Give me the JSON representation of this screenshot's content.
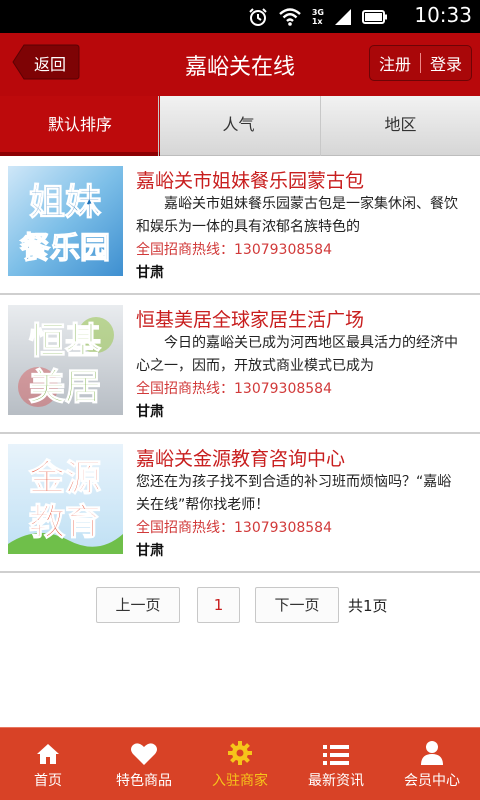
{
  "status_bar": {
    "time": "10:33",
    "net_top": "3G",
    "net_bottom": "1x"
  },
  "header": {
    "back_label": "返回",
    "title": "嘉峪关在线",
    "register_label": "注册",
    "login_label": "登录"
  },
  "tabs": [
    {
      "label": "默认排序",
      "active": true
    },
    {
      "label": "人气",
      "active": false
    },
    {
      "label": "地区",
      "active": false
    }
  ],
  "items": [
    {
      "title": "嘉峪关市姐妹餐乐园蒙古包",
      "desc": "嘉峪关市姐妹餐乐园蒙古包是一家集休闲、餐饮和娱乐为一体的具有浓郁名族特色的",
      "phone": "全国招商热线：13079308584",
      "region": "甘肃",
      "thumb_text": [
        "姐妹",
        "餐乐园"
      ]
    },
    {
      "title": "恒基美居全球家居生活广场",
      "desc": "今日的嘉峪关已成为河西地区最具活力的经济中心之一，因而，开放式商业模式已成为",
      "phone": "全国招商热线：13079308584",
      "region": "甘肃",
      "thumb_text": [
        "恒基",
        "美居"
      ]
    },
    {
      "title": "嘉峪关金源教育咨询中心",
      "desc": "您还在为孩子找不到合适的补习班而烦恼吗？“嘉峪关在线”帮你找老师！",
      "phone": "全国招商热线：13079308584",
      "region": "甘肃",
      "thumb_text": [
        "金源",
        "教育"
      ]
    }
  ],
  "pager": {
    "prev_label": "上一页",
    "current_page": "1",
    "next_label": "下一页",
    "total_label": "共1页"
  },
  "bottom_nav": [
    {
      "label": "首页",
      "icon": "home-icon",
      "active": false
    },
    {
      "label": "特色商品",
      "icon": "heart-icon",
      "active": false
    },
    {
      "label": "入驻商家",
      "icon": "gear-icon",
      "active": true
    },
    {
      "label": "最新资讯",
      "icon": "list-icon",
      "active": false
    },
    {
      "label": "会员中心",
      "icon": "user-icon",
      "active": false
    }
  ],
  "colors": {
    "header": "#b8080b",
    "accent_red": "#c81e1e",
    "bottom_nav": "#d84226",
    "nav_active": "#f6c51a"
  }
}
